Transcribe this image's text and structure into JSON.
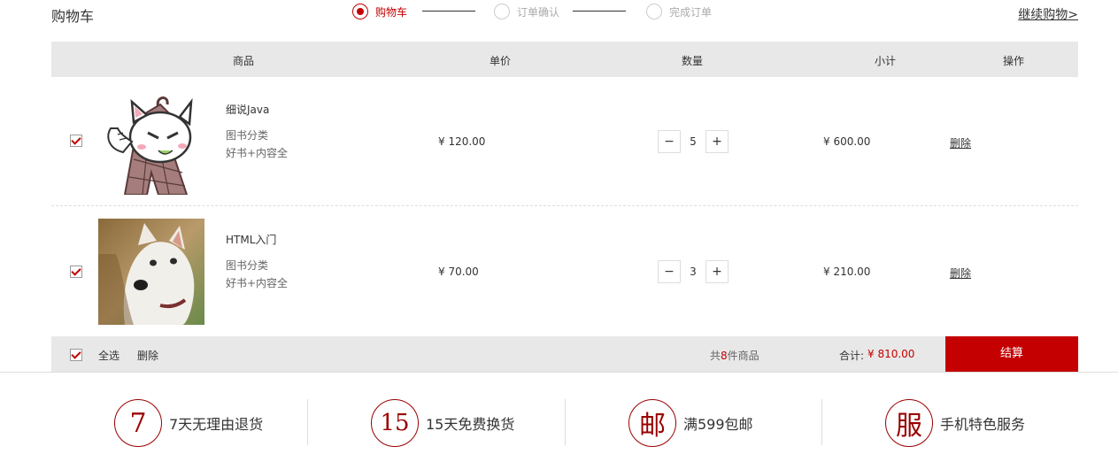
{
  "header": {
    "title": "购物车",
    "continue_label": "继续购物>"
  },
  "steps": [
    {
      "label": "购物车",
      "active": true
    },
    {
      "label": "订单确认",
      "active": false
    },
    {
      "label": "完成订单",
      "active": false
    }
  ],
  "table": {
    "columns": [
      "商品",
      "单价",
      "数量",
      "小计",
      "操作"
    ]
  },
  "items": [
    {
      "name": "细说Java",
      "category": "图书分类",
      "tag": "好书+内容全",
      "price": "¥ 120.00",
      "quantity": "5",
      "subtotal": "¥ 600.00",
      "delete_label": "删除",
      "checked": true,
      "image": "cartoon-cat-image"
    },
    {
      "name": "HTML入门",
      "category": "图书分类",
      "tag": "好书+内容全",
      "price": "¥ 70.00",
      "quantity": "3",
      "subtotal": "¥ 210.00",
      "delete_label": "删除",
      "checked": true,
      "image": "white-dog-photo"
    }
  ],
  "footer": {
    "select_all_label": "全选",
    "delete_label": "删除",
    "count_prefix": "共",
    "count": "8",
    "count_suffix": "件商品",
    "total_label": "合计:",
    "total_value": "¥ 810.00",
    "checkout_label": "结算"
  },
  "services": [
    {
      "symbol": "7",
      "text": "7天无理由退货"
    },
    {
      "symbol": "15",
      "text": "15天免费换货"
    },
    {
      "symbol": "邮",
      "text": "满599包邮"
    },
    {
      "symbol": "服",
      "text": "手机特色服务"
    }
  ],
  "colors": {
    "accent": "#c40000",
    "service_ring": "#9a0000",
    "header_bg": "#e8e8e8"
  }
}
